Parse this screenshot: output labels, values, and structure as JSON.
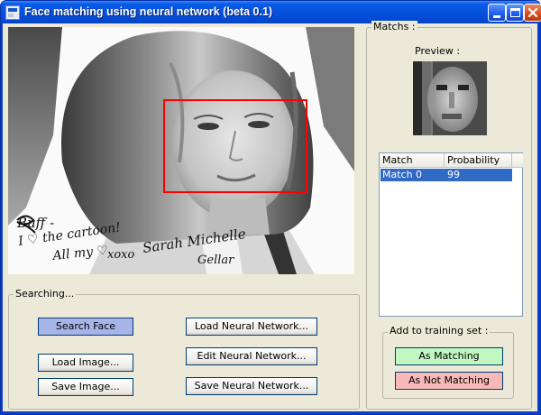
{
  "window": {
    "title": "Face matching using neural network (beta 0.1)"
  },
  "photo": {
    "caption_lines": [
      "Buff -",
      "I ♡ the cartoon!",
      "All my ♡",
      "xoxo",
      "Sarah Michelle",
      "Gellar"
    ]
  },
  "matches": {
    "legend": "Matchs :",
    "preview_label": "Preview :",
    "columns": [
      "Match",
      "Probability"
    ],
    "rows": [
      {
        "match": "Match 0",
        "probability": "99"
      }
    ]
  },
  "searching": {
    "legend": "Searching...",
    "search_face": "Search Face",
    "load_image": "Load Image...",
    "save_image": "Save Image...",
    "load_network": "Load Neural Network...",
    "edit_network": "Edit Neural Network...",
    "save_network": "Save Neural Network..."
  },
  "training": {
    "legend": "Add to training set :",
    "as_matching": "As Matching",
    "as_not_matching": "As Not Matching"
  },
  "colors": {
    "title_bar": "#0a5ce8",
    "face_box": "#ff0000",
    "search_face_bg": "#a6b4e8",
    "as_matching_bg": "#c0f8c0",
    "as_not_matching_bg": "#f8b8b8",
    "selection": "#316ac5"
  }
}
